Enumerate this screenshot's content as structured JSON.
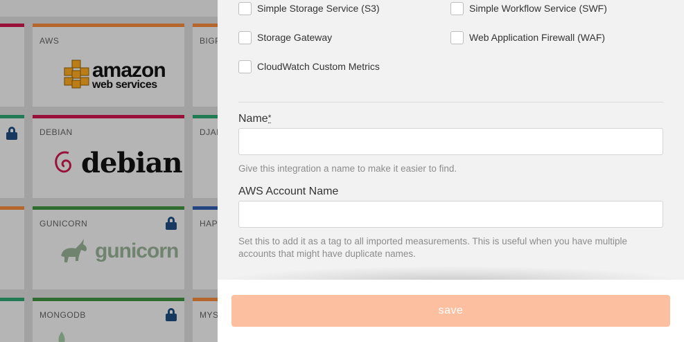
{
  "background_grid": {
    "tiles": [
      {
        "label": "AWS",
        "accent": "#e8833a"
      },
      {
        "label": "BIGP",
        "accent": "#e8833a"
      },
      {
        "label": "DEBIAN",
        "accent": "#c5174b"
      },
      {
        "label": "DJAN",
        "accent": "#2a9d6b"
      },
      {
        "label": "GUNICORN",
        "accent": "#3d8b3d"
      },
      {
        "label": "HAPP",
        "accent": "#2e5aa8"
      },
      {
        "label": "MONGODB",
        "accent": "#3d8b3d"
      },
      {
        "label": "MYSQ",
        "accent": "#e8833a"
      }
    ],
    "logos": {
      "amazon_line1": "amazon",
      "amazon_line2": "web services",
      "debian": "debian",
      "gunicorn": "gunicorn"
    }
  },
  "services": {
    "left": [
      {
        "label": "Simple Storage Service (S3)",
        "checked": false
      },
      {
        "label": "Storage Gateway",
        "checked": false
      },
      {
        "label": "CloudWatch Custom Metrics",
        "checked": false
      }
    ],
    "right": [
      {
        "label": "Simple Workflow Service (SWF)",
        "checked": false
      },
      {
        "label": "Web Application Firewall (WAF)",
        "checked": false
      }
    ]
  },
  "form": {
    "name": {
      "label": "Name",
      "required_marker": "*",
      "value": "",
      "help": "Give this integration a name to make it easier to find."
    },
    "aws_account_name": {
      "label": "AWS Account Name",
      "value": "",
      "help": "Set this to add it as a tag to all imported measurements. This is useful when you have multiple accounts that might have duplicate names."
    }
  },
  "actions": {
    "save_label": "save",
    "save_color": "#fcc0a0"
  },
  "colors": {
    "lock": "#1e4a7c",
    "panel_bg": "#f2f2f2"
  }
}
